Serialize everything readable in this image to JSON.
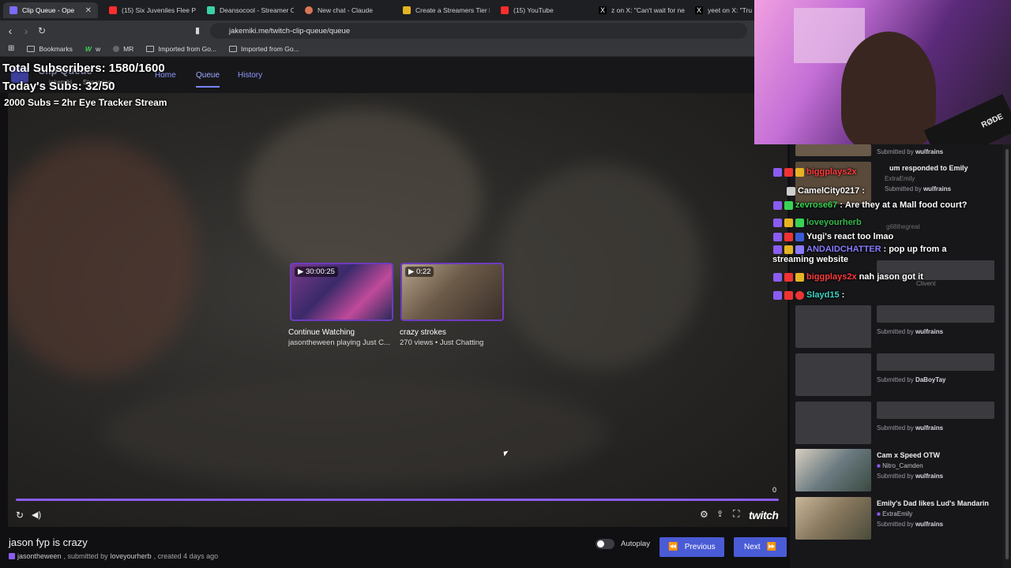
{
  "browser": {
    "tabs": [
      {
        "label": "Clip Queue - Ope",
        "color": "#7a6cff",
        "active": true
      },
      {
        "label": "(15) Six Juveniles Flee Po",
        "color": "#ff2d2d"
      },
      {
        "label": "Deansocool - Streamer O",
        "color": "#3bd1a6"
      },
      {
        "label": "New chat - Claude",
        "color": "#d97757"
      },
      {
        "label": "Create a Streamers Tier L",
        "color": "#e6b422"
      },
      {
        "label": "(15) YouTube",
        "color": "#ff2d2d"
      },
      {
        "label": "z on X: \"Can't wait for ne",
        "color": "#ffffff"
      },
      {
        "label": "yeet on X: \"Tru",
        "color": "#ffffff"
      }
    ],
    "url": "jakemiki.me/twitch-clip-queue/queue",
    "bookmarks": [
      "Bookmarks",
      "w",
      "MR",
      "Imported from Go...",
      "Imported from Go..."
    ]
  },
  "app": {
    "brand": "Clip Queue",
    "brand_sub_1": "jakemiki",
    "brand_sub_2": "Streaming",
    "nav": [
      "Home",
      "Queue",
      "History"
    ]
  },
  "stream_overlay": {
    "line1": "Total Subscribers: 1580/1600",
    "line2": "Today's Subs: 32/50",
    "line3": "2000 Subs = 2hr Eye Tracker Stream"
  },
  "player": {
    "videos": [
      {
        "duration": "30:00:25",
        "title": "Continue Watching",
        "subtitle": "jasontheween playing Just C..."
      },
      {
        "duration": "0:22",
        "title": "crazy strokes",
        "subtitle": "270 views • Just Chatting"
      }
    ],
    "counter": "0",
    "logo": "twitch",
    "progress": 1.0
  },
  "clip": {
    "title": "jason fyp is crazy",
    "channel": "jasontheween",
    "submitted_prefix": ", submitted by",
    "submitter": "loveyourherb",
    "created": ", created 4 days ago"
  },
  "controls": {
    "autoplay_label": "Autoplay",
    "previous_label": "Previous",
    "next_label": "Next"
  },
  "chat": [
    {
      "user": "biggplays2x",
      "user_color": "#ff3b3b",
      "message": ""
    },
    {
      "user": "CamelCity0217",
      "user_color": "#ffffff",
      "message": ""
    },
    {
      "user": "zevrose67",
      "user_color": "#39d353",
      "message": "Are they at a Mall food court?"
    },
    {
      "user": "loveyourherb",
      "user_color": "#39d353",
      "message": ""
    },
    {
      "user": "Yugi's react too lmao",
      "user_color": "#ff3b3b",
      "message": ""
    },
    {
      "user": "ANDAIDCHATTER",
      "user_color": "#8a7bff",
      "message": "pop up from a"
    },
    {
      "user": "",
      "user_color": "#ffffff",
      "message": "streaming website"
    },
    {
      "user": "biggplays2x",
      "user_color": "#ff3b3b",
      "message": "nah jason got it"
    },
    {
      "user": "Slayd15",
      "user_color": "#39d3c4",
      "message": ""
    }
  ],
  "queue": {
    "submitted_by": "Submitted by",
    "items": [
      {
        "title": "",
        "channel": "",
        "submitter": "wulfrains"
      },
      {
        "title": "um responded to Emily",
        "channel": "ExtraEmily",
        "submitter": "wulfrains"
      },
      {
        "title": "",
        "channel": "g68thegreat",
        "submitter": ""
      },
      {
        "title": "",
        "channel": "Clivent",
        "submitter": ""
      },
      {
        "title": "",
        "channel": "",
        "submitter": "wulfrains"
      },
      {
        "title": "",
        "channel": "",
        "submitter": "DaBoyTay"
      },
      {
        "title": "",
        "channel": "",
        "submitter": "wulfrains"
      },
      {
        "title": "Cam x Speed OTW",
        "channel": "Nitro_Camden",
        "submitter": "wulfrains"
      },
      {
        "title": "Emily's Dad likes Lud's Mandarin",
        "channel": "ExtraEmily",
        "submitter": "wulfrains"
      }
    ]
  },
  "webcam": {
    "mic_label": "RØDE"
  }
}
